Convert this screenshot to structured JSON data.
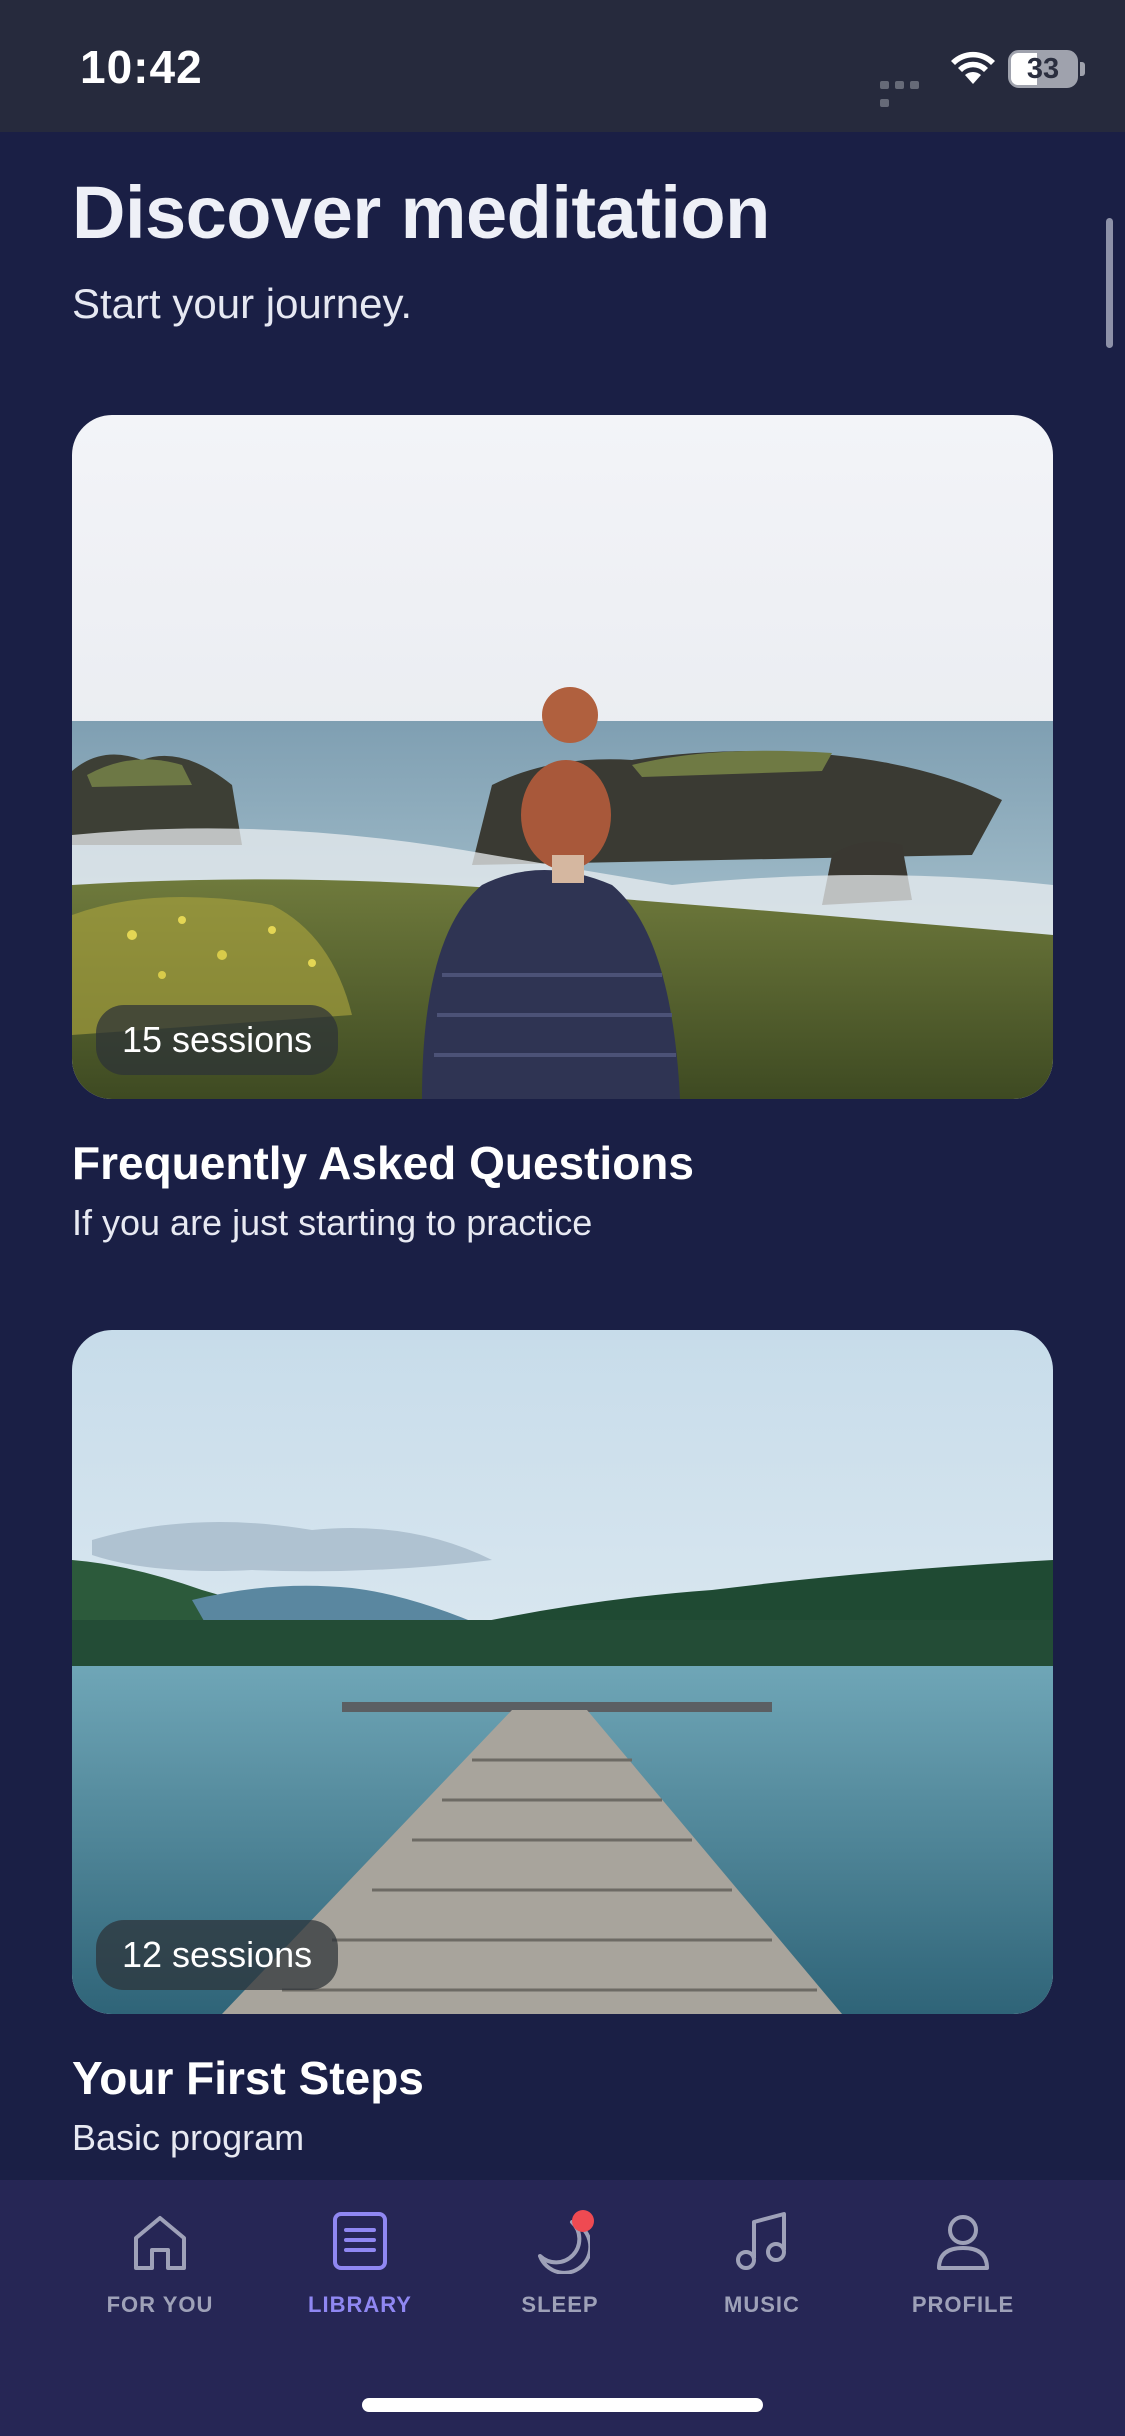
{
  "status_bar": {
    "time": "10:42",
    "battery": "33"
  },
  "header": {
    "title": "Discover meditation",
    "subtitle": "Start your journey."
  },
  "cards": [
    {
      "sessions": "15 sessions",
      "title": "Frequently Asked Questions",
      "description": "If you are just starting to practice",
      "image": "woman-overlooking-rocky-coast"
    },
    {
      "sessions": "12 sessions",
      "title": "Your First Steps",
      "description": "Basic program",
      "image": "wooden-dock-on-mountain-lake"
    }
  ],
  "tab_bar": {
    "items": [
      {
        "label": "FOR YOU",
        "icon": "home-icon",
        "active": false
      },
      {
        "label": "LIBRARY",
        "icon": "library-icon",
        "active": true
      },
      {
        "label": "SLEEP",
        "icon": "moon-icon",
        "active": false,
        "badge": true
      },
      {
        "label": "MUSIC",
        "icon": "music-note-icon",
        "active": false
      },
      {
        "label": "PROFILE",
        "icon": "profile-icon",
        "active": false
      }
    ]
  },
  "colors": {
    "background": "#1a1f45",
    "tab_bar": "#262655",
    "accent": "#8f87f2",
    "notification": "#ef4a52",
    "inactive": "#9ea1b8"
  }
}
